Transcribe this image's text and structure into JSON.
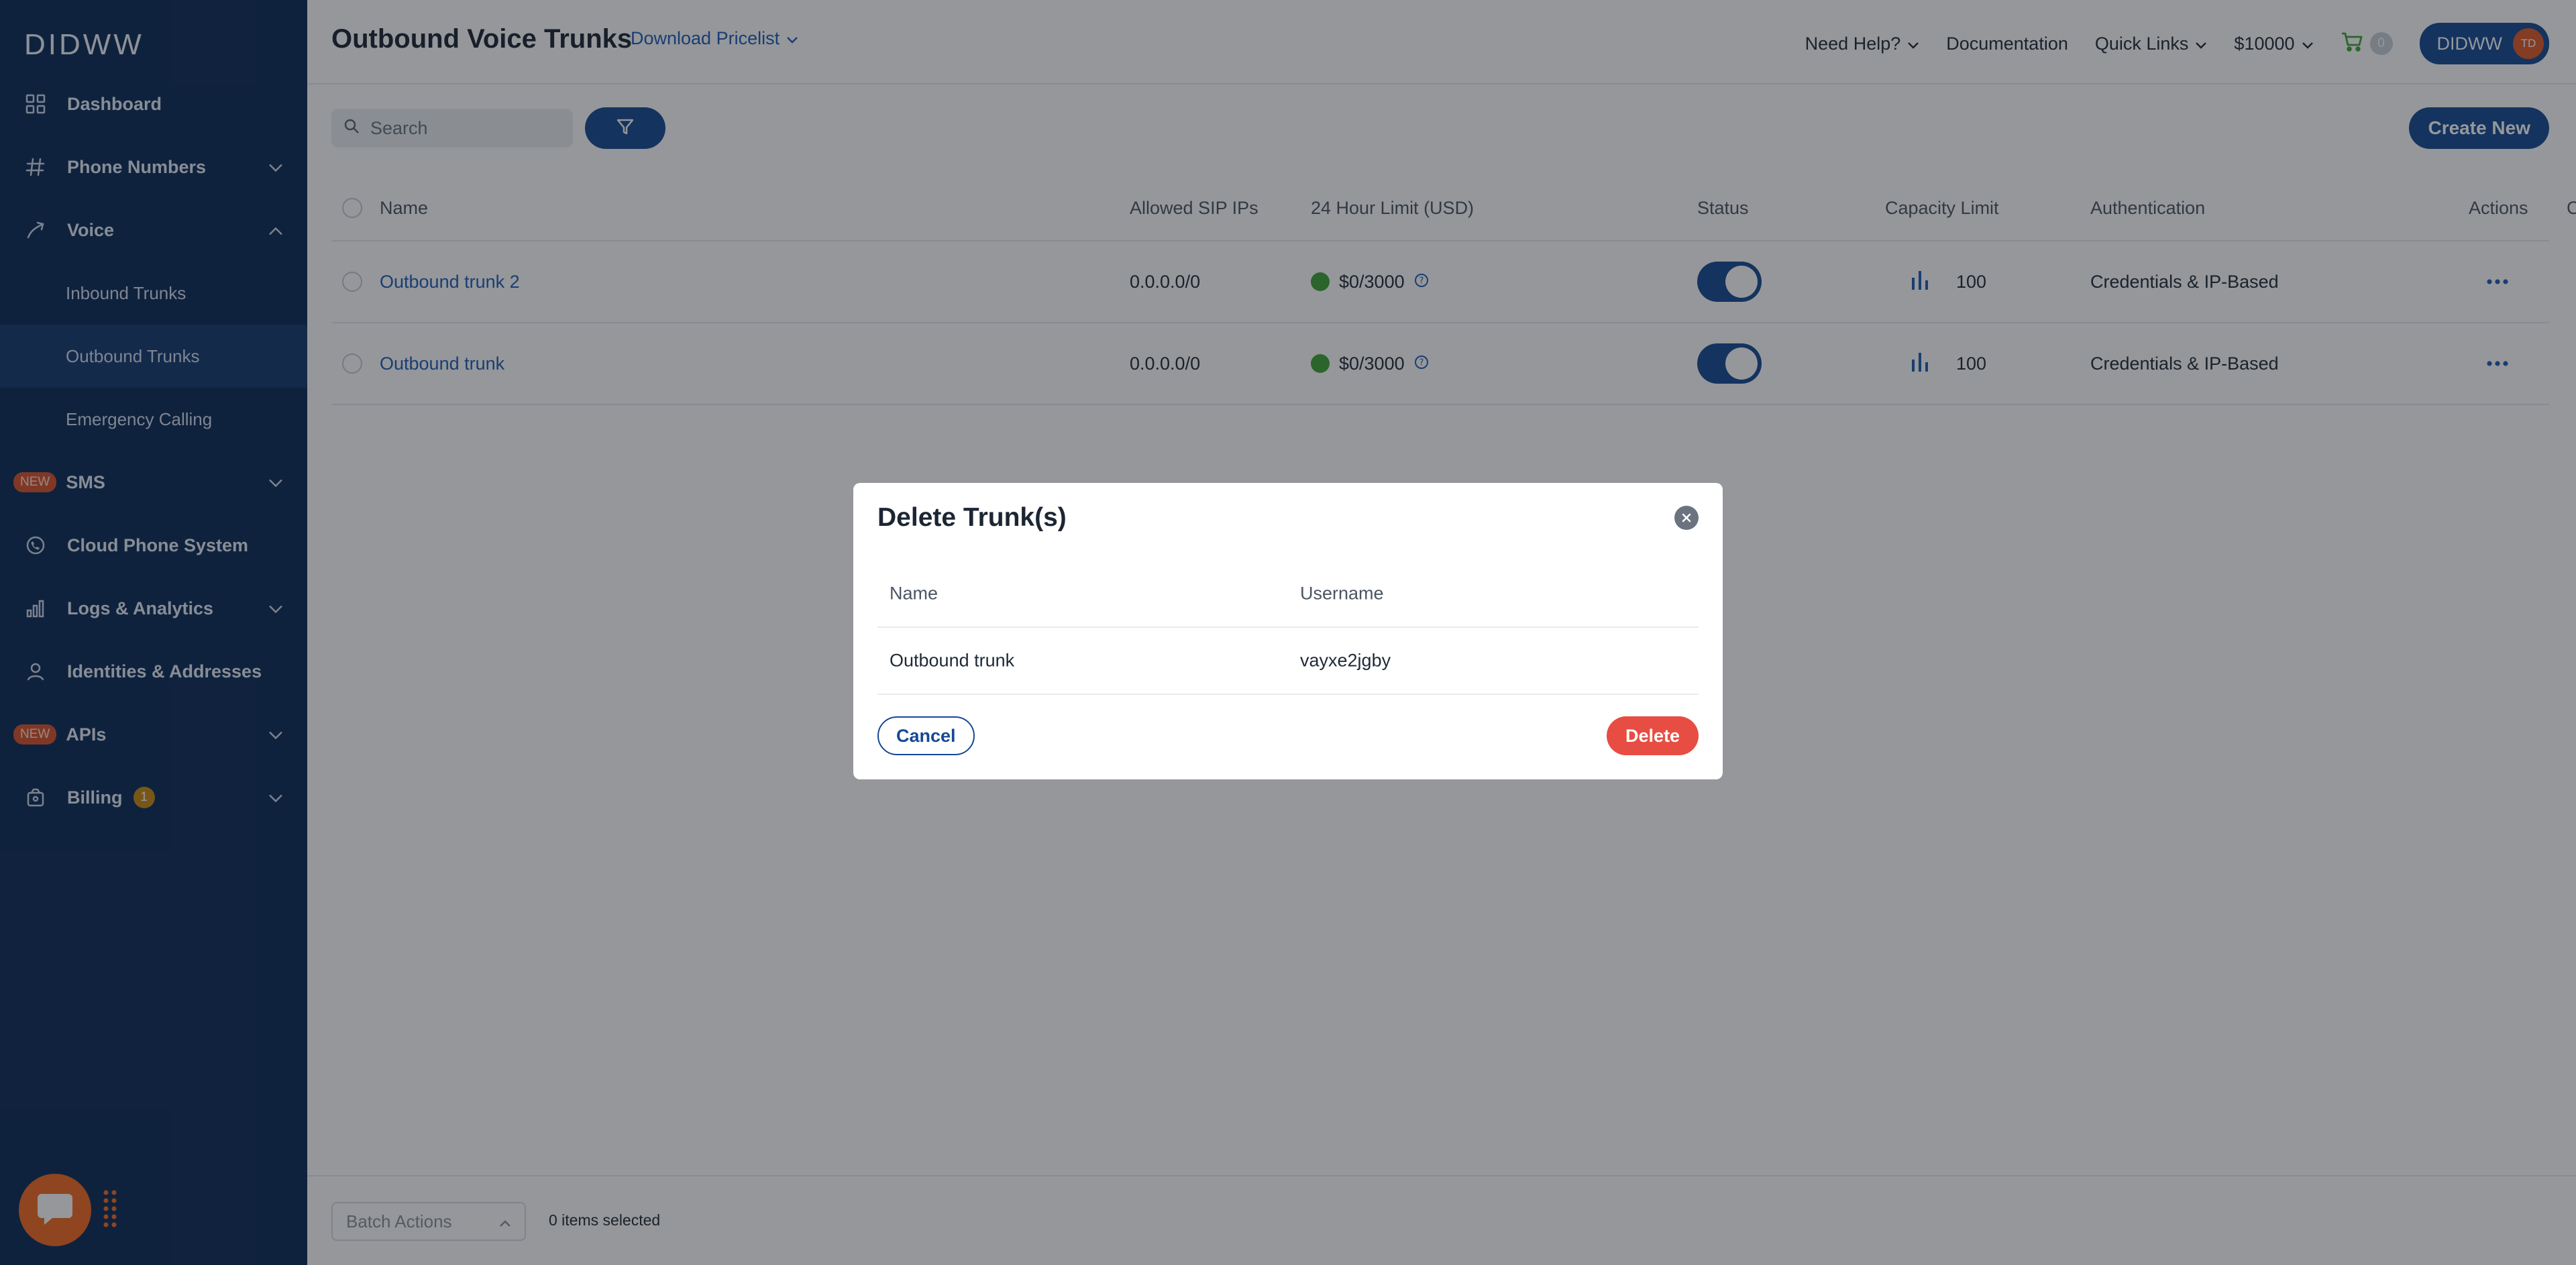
{
  "brand": {
    "logo": "DIDWW"
  },
  "sidebar": {
    "items": [
      {
        "label": "Dashboard",
        "icon": "grid-icon"
      },
      {
        "label": "Phone Numbers",
        "icon": "hash-icon"
      },
      {
        "label": "Voice",
        "icon": "phone-transfer-icon"
      },
      {
        "label": "Inbound Trunks"
      },
      {
        "label": "Outbound Trunks"
      },
      {
        "label": "Emergency Calling"
      },
      {
        "label": "SMS",
        "badge": "NEW"
      },
      {
        "label": "Cloud Phone System",
        "icon": "phone-circle-icon"
      },
      {
        "label": "Logs & Analytics",
        "icon": "bar-chart-icon"
      },
      {
        "label": "Identities & Addresses",
        "icon": "user-icon"
      },
      {
        "label": "APIs",
        "badge": "NEW"
      },
      {
        "label": "Billing",
        "icon": "wallet-icon",
        "count": "1"
      }
    ]
  },
  "header": {
    "title": "Outbound Voice Trunks",
    "pricelist": "Download Pricelist",
    "need_help": "Need Help?",
    "documentation": "Documentation",
    "quick_links": "Quick Links",
    "balance": "$10000",
    "cart_count": "0",
    "user_label": "DIDWW",
    "avatar_initials": "TD"
  },
  "toolbar": {
    "search_placeholder": "Search",
    "create_new": "Create New"
  },
  "table": {
    "columns": [
      "Name",
      "Allowed SIP IPs",
      "24 Hour Limit (USD)",
      "Status",
      "Capacity Limit",
      "Authentication",
      "Credentials",
      "Actions"
    ],
    "rows": [
      {
        "name": "Outbound trunk 2",
        "ips": "0.0.0.0/0",
        "limit": "$0/3000",
        "capacity": "100",
        "auth": "Credentials & IP-Based"
      },
      {
        "name": "Outbound trunk",
        "ips": "0.0.0.0/0",
        "limit": "$0/3000",
        "capacity": "100",
        "auth": "Credentials & IP-Based"
      }
    ]
  },
  "footer": {
    "batch_actions": "Batch Actions",
    "selected": "0 items selected"
  },
  "modal": {
    "title": "Delete Trunk(s)",
    "col_name": "Name",
    "col_username": "Username",
    "row_name": "Outbound trunk",
    "row_username": "vayxe2jgby",
    "cancel": "Cancel",
    "delete": "Delete"
  },
  "colors": {
    "sidebar": "#0c2a57",
    "primary": "#154994",
    "danger": "#e74d42",
    "accent_orange": "#f26b21",
    "status_green": "#3fa535"
  }
}
